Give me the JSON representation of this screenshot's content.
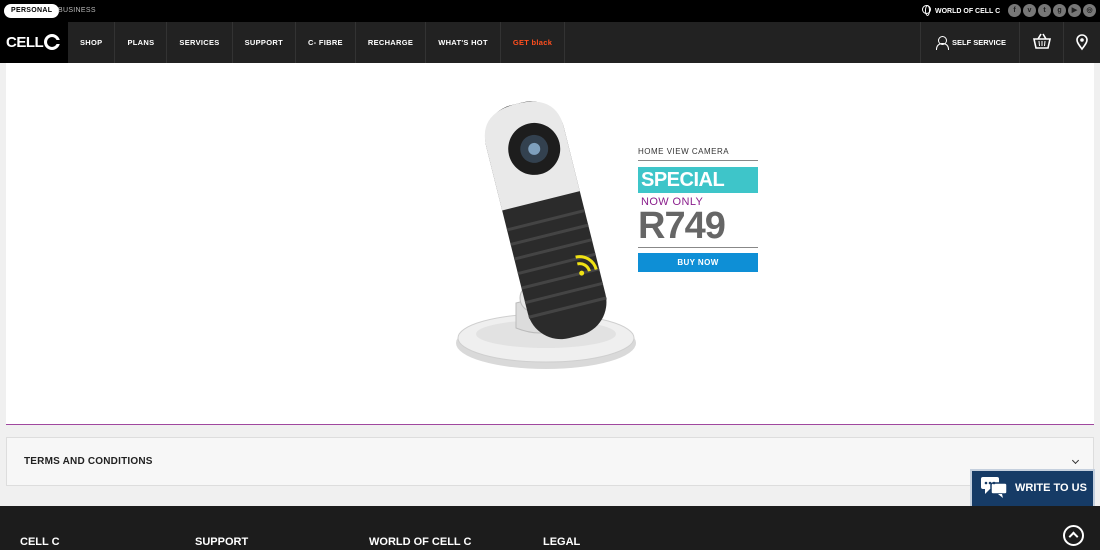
{
  "topbar": {
    "segments": [
      "PERSONAL",
      "BUSINESS"
    ],
    "world_link": "WORLD OF CELL C",
    "social_icons": [
      "facebook-icon",
      "vine-icon",
      "twitter-icon",
      "google-plus-icon",
      "youtube-icon",
      "instagram-icon"
    ]
  },
  "nav": {
    "logo": "CELL",
    "items": [
      "SHOP",
      "PLANS",
      "SERVICES",
      "SUPPORT",
      "C- FIBRE",
      "RECHARGE",
      "WHAT'S HOT",
      "GET black"
    ],
    "self_service": "SELF SERVICE"
  },
  "banner": {
    "product_name": "HOME VIEW CAMERA",
    "badge": "SPECIAL",
    "now_only": "NOW ONLY",
    "price": "R749",
    "cta": "BUY NOW",
    "colors": {
      "badge": "#3ec5c9",
      "now_only": "#8a1e8c",
      "cta": "#0e8fd6"
    }
  },
  "terms": {
    "title": "TERMS AND CONDITIONS"
  },
  "chat": {
    "label": "WRITE TO US"
  },
  "footer": {
    "columns": [
      "CELL C",
      "SUPPORT",
      "WORLD OF CELL C",
      "LEGAL"
    ]
  }
}
